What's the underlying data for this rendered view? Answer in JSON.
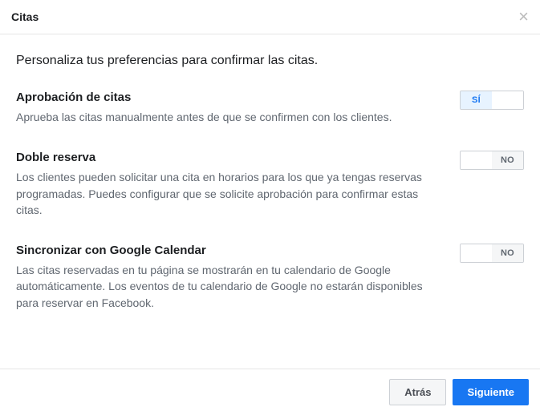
{
  "dialog": {
    "title": "Citas",
    "intro": "Personaliza tus preferencias para confirmar las citas."
  },
  "toggle": {
    "on_label": "SÍ",
    "off_label": "NO"
  },
  "sections": {
    "approval": {
      "title": "Aprobación de citas",
      "desc": "Aprueba las citas manualmente antes de que se confirmen con los clientes.",
      "state": "on"
    },
    "double_booking": {
      "title": "Doble reserva",
      "desc": "Los clientes pueden solicitar una cita en horarios para los que ya tengas reservas programadas. Puedes configurar que se solicite aprobación para confirmar estas citas.",
      "state": "off"
    },
    "calendar_sync": {
      "title": "Sincronizar con Google Calendar",
      "desc": "Las citas reservadas en tu página se mostrarán en tu calendario de Google automáticamente. Los eventos de tu calendario de Google no estarán disponibles para reservar en Facebook.",
      "state": "off"
    }
  },
  "footer": {
    "back": "Atrás",
    "next": "Siguiente"
  }
}
